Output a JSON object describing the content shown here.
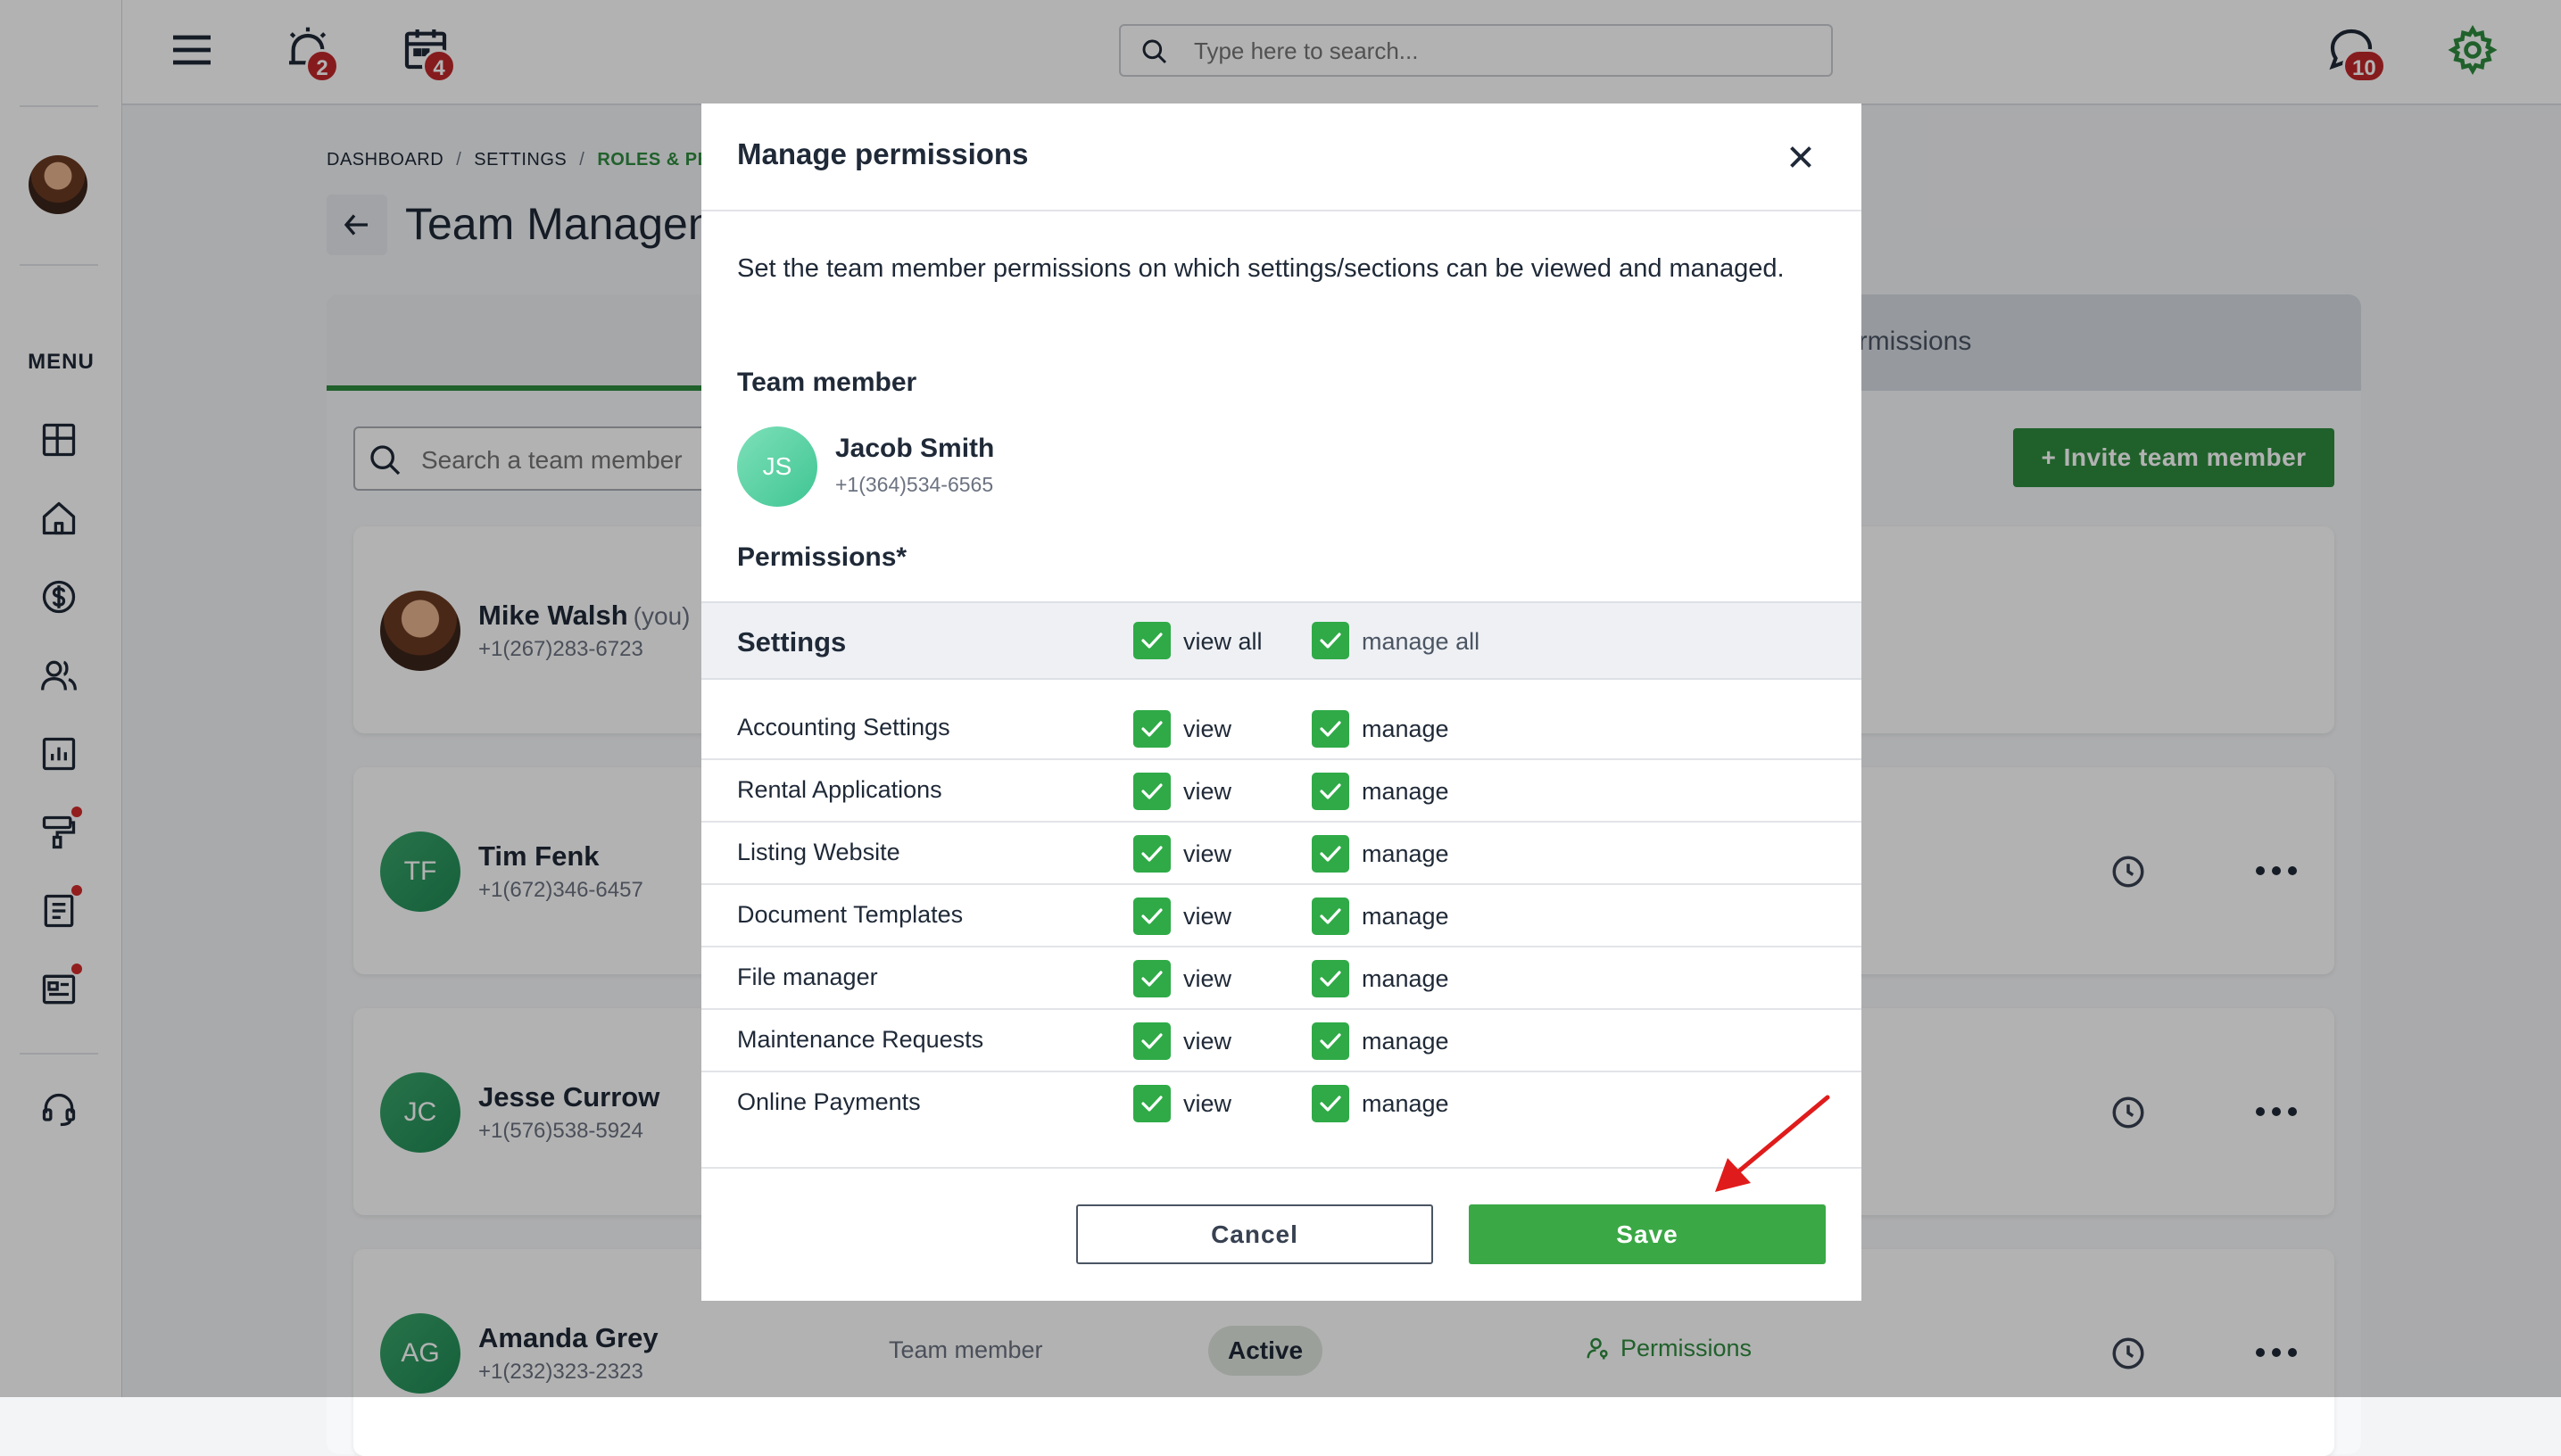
{
  "header": {
    "search_placeholder": "Type here to search...",
    "alerts_badge": "2",
    "calendar_badge": "4",
    "messages_badge": "10"
  },
  "sidebar": {
    "menu_label": "MENU"
  },
  "breadcrumb": {
    "items": [
      "DASHBOARD",
      "SETTINGS",
      "ROLES & PER"
    ]
  },
  "page": {
    "title": "Team Managen",
    "tab_label": "ermissions",
    "member_search_placeholder": "Search a team member",
    "invite_label": "+ Invite team member"
  },
  "members": [
    {
      "initials": "",
      "name": "Mike Walsh",
      "you": "(you)",
      "phone": "+1(267)283-6723"
    },
    {
      "initials": "TF",
      "name": "Tim Fenk",
      "phone": "+1(672)346-6457"
    },
    {
      "initials": "JC",
      "name": "Jesse Currow",
      "phone": "+1(576)538-5924"
    },
    {
      "initials": "AG",
      "name": "Amanda Grey",
      "phone": "+1(232)323-2323",
      "role": "Team member",
      "status": "Active",
      "permissions_link": "Permissions"
    }
  ],
  "modal": {
    "title": "Manage permissions",
    "description": "Set the team member permissions on which settings/sections can be viewed and managed.",
    "team_member_label": "Team member",
    "member": {
      "initials": "JS",
      "name": "Jacob Smith",
      "phone": "+1(364)534-6565"
    },
    "permissions_label": "Permissions*",
    "settings_group": {
      "label": "Settings",
      "view_all": "view all",
      "manage_all": "manage all"
    },
    "view_label": "view",
    "manage_label": "manage",
    "rows": [
      {
        "label": "Accounting Settings"
      },
      {
        "label": "Rental Applications"
      },
      {
        "label": "Listing Website"
      },
      {
        "label": "Document Templates"
      },
      {
        "label": "File manager"
      },
      {
        "label": "Maintenance Requests"
      },
      {
        "label": "Online Payments"
      }
    ],
    "cancel_label": "Cancel",
    "save_label": "Save"
  },
  "colors": {
    "brand_green": "#2e8b3e",
    "checkbox_green": "#2faa47",
    "badge_red": "#c0282a",
    "annotation_arrow": "#e01b1b"
  }
}
